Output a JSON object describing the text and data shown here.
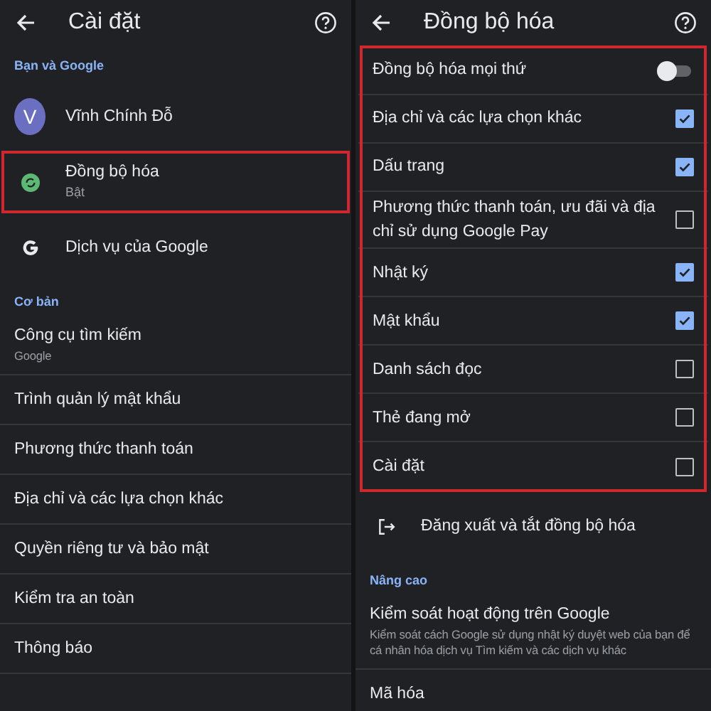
{
  "left": {
    "title": "Cài đặt",
    "items": [
      {
        "kind": "section",
        "label": "Bạn và Google"
      },
      {
        "kind": "account",
        "label": "Vĩnh Chính Đỗ",
        "initial": "V"
      },
      {
        "kind": "sync",
        "label": "Đồng bộ hóa",
        "subtitle": "Bật",
        "highlighted": true
      },
      {
        "kind": "google",
        "label": "Dịch vụ của Google",
        "highlighted": false
      },
      {
        "kind": "section",
        "label": "Cơ bản"
      },
      {
        "kind": "row",
        "label": "Công cụ tìm kiếm",
        "subtitle": "Google"
      },
      {
        "kind": "row",
        "label": "Trình quản lý mật khẩu"
      },
      {
        "kind": "row",
        "label": "Phương thức thanh toán"
      },
      {
        "kind": "row",
        "label": "Địa chỉ và các lựa chọn khác"
      },
      {
        "kind": "row",
        "label": "Quyền riêng tư và bảo mật"
      },
      {
        "kind": "row",
        "label": "Kiểm tra an toàn"
      },
      {
        "kind": "row",
        "label": "Thông báo"
      }
    ]
  },
  "right": {
    "title": "Đồng bộ hóa",
    "sync_options_highlighted": true,
    "sync_options": [
      {
        "kind": "toggle",
        "label": "Đồng bộ hóa mọi thứ",
        "on": false
      },
      {
        "kind": "checkbox",
        "label": "Địa chỉ và các lựa chọn khác",
        "checked": true
      },
      {
        "kind": "checkbox",
        "label": "Dấu trang",
        "checked": true
      },
      {
        "kind": "checkbox",
        "label": "Phương thức thanh toán, ưu đãi và địa chỉ sử dụng Google Pay",
        "checked": false
      },
      {
        "kind": "checkbox",
        "label": "Nhật ký",
        "checked": true
      },
      {
        "kind": "checkbox",
        "label": "Mật khẩu",
        "checked": true
      },
      {
        "kind": "checkbox",
        "label": "Danh sách đọc",
        "checked": false
      },
      {
        "kind": "checkbox",
        "label": "Thẻ đang mở",
        "checked": false
      },
      {
        "kind": "checkbox",
        "label": "Cài đặt",
        "checked": false
      }
    ],
    "items": [
      {
        "kind": "signout",
        "label": "Đăng xuất và tắt đồng bộ hóa"
      },
      {
        "kind": "section",
        "label": "Nâng cao"
      },
      {
        "kind": "row",
        "label": "Kiểm soát hoạt động trên Google",
        "subtitle": "Kiểm soát cách Google sử dụng nhật ký duyệt web của bạn để cá nhân hóa dịch vụ Tìm kiếm và các dịch vụ khác"
      },
      {
        "kind": "row",
        "label": "Mã hóa"
      }
    ]
  }
}
